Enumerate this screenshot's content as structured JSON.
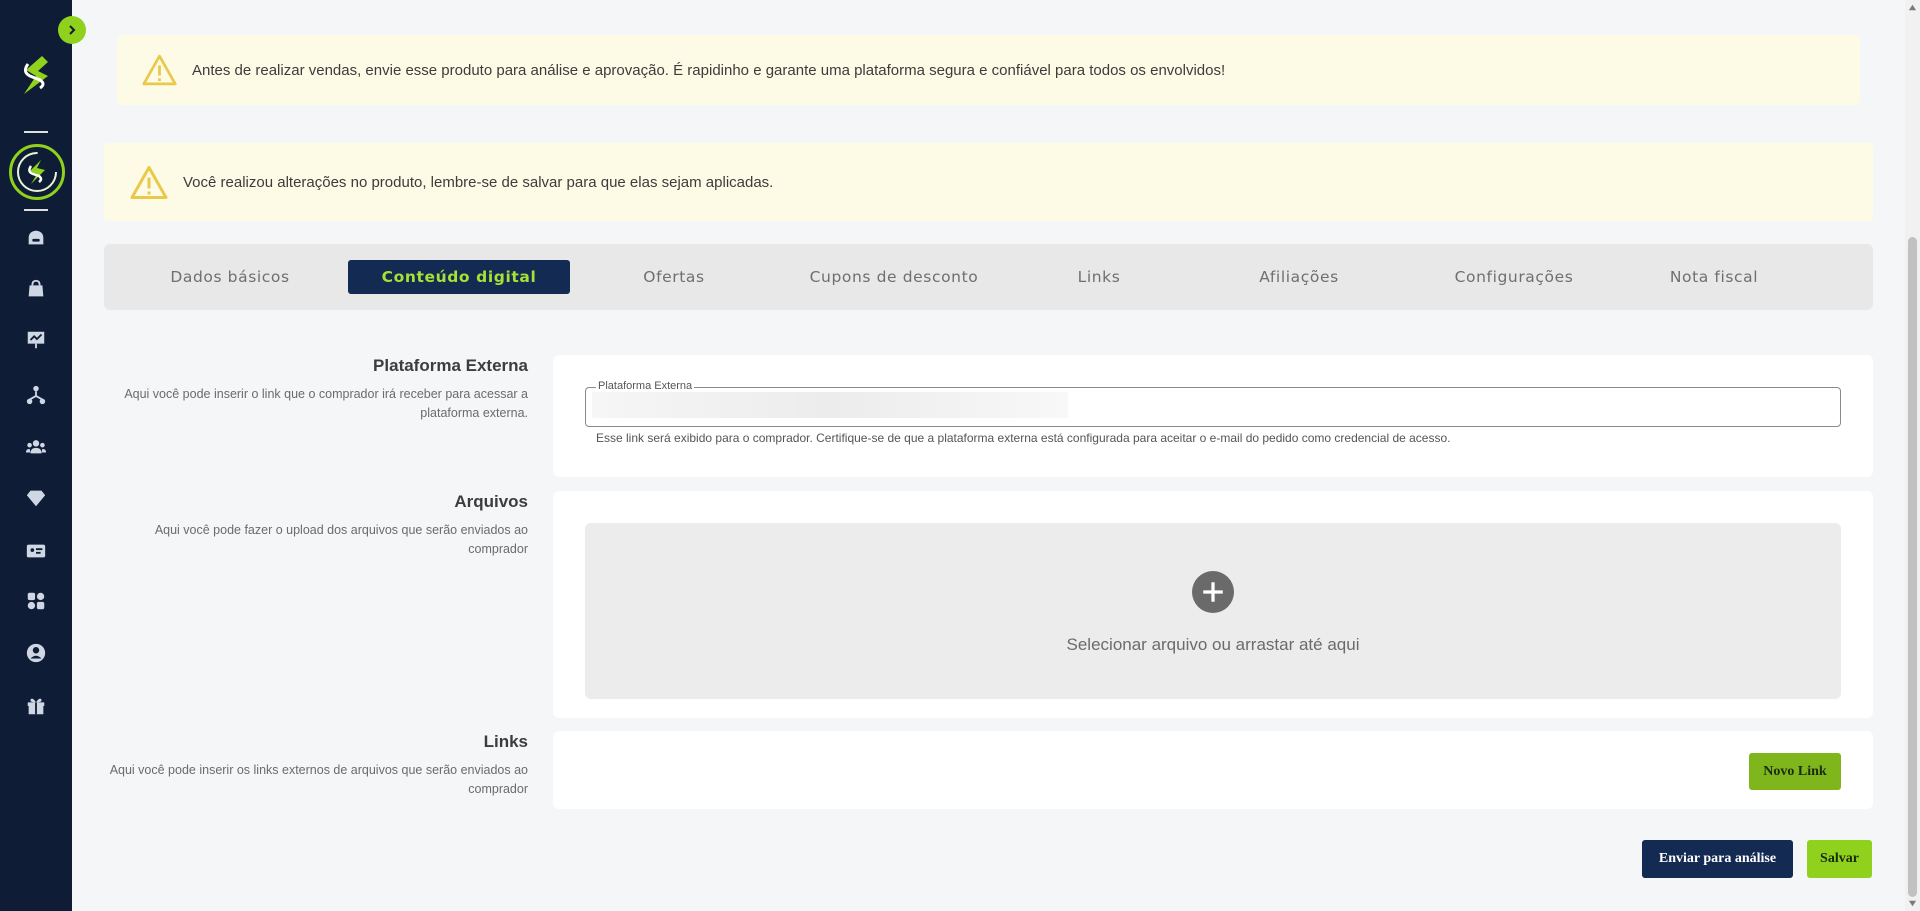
{
  "alerts": {
    "analysis": "Antes de realizar vendas, envie esse produto para análise e aprovação. É rapidinho e garante uma plataforma segura e confiável para todos os envolvidos!",
    "unsaved": "Você realizou alterações no produto, lembre-se de salvar para que elas sejam aplicadas."
  },
  "tabs": [
    {
      "label": "Dados básicos"
    },
    {
      "label": "Conteúdo digital"
    },
    {
      "label": "Ofertas"
    },
    {
      "label": "Cupons de desconto"
    },
    {
      "label": "Links"
    },
    {
      "label": "Afiliações"
    },
    {
      "label": "Configurações"
    },
    {
      "label": "Nota fiscal"
    }
  ],
  "active_tab": "Conteúdo digital",
  "sections": {
    "external": {
      "title": "Plataforma Externa",
      "desc_line1": "Aqui você pode inserir o link que o comprador irá receber para acessar a",
      "desc_line2": "plataforma externa.",
      "field_label": "Plataforma Externa",
      "help": "Esse link será exibido para o comprador. Certifique-se de que a plataforma externa está configurada para aceitar o e-mail do pedido como credencial de acesso."
    },
    "files": {
      "title": "Arquivos",
      "desc_line1": "Aqui você pode fazer o upload dos arquivos que serão enviados ao",
      "desc_line2": "comprador",
      "dropzone_text": "Selecionar arquivo ou arrastar até aqui"
    },
    "links": {
      "title": "Links",
      "desc_line1": "Aqui você pode inserir os links externos de arquivos que serão enviados ao",
      "desc_line2": "comprador",
      "new_link_label": "Novo Link"
    }
  },
  "actions": {
    "send_label": "Enviar para análise",
    "save_label": "Salvar"
  },
  "colors": {
    "sidebar": "#0e1c36",
    "accent_green": "#8fd11c",
    "tab_active_bg": "#132a52",
    "alert_bg": "#fdfbe6",
    "warning_yellow": "#e9c94a"
  },
  "sidebar_icons": [
    "home-icon",
    "shopping-bag-icon",
    "presentation-chart-icon",
    "network-icon",
    "users-icon",
    "diamond-icon",
    "id-card-icon",
    "apps-icon",
    "user-circle-icon",
    "gift-icon"
  ]
}
